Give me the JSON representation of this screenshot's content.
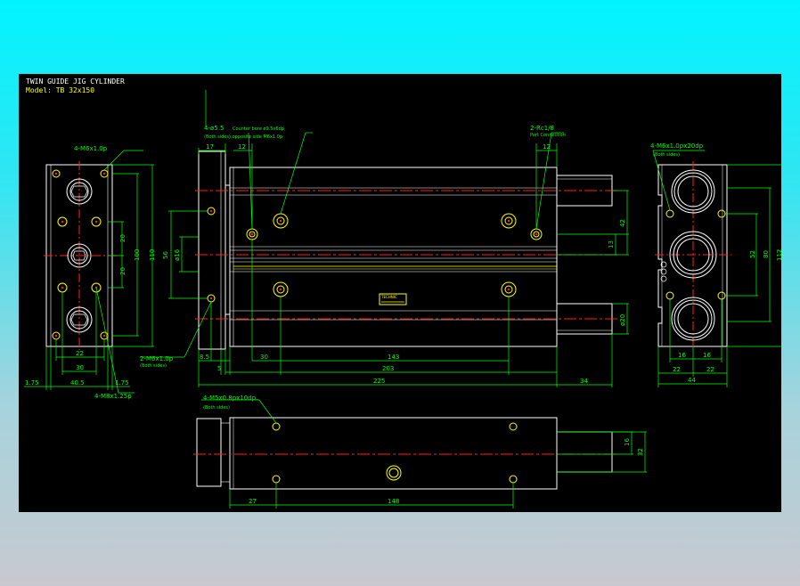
{
  "drawing": {
    "title": "TWIN GUIDE JIG CYLINDER",
    "model": "Model: TB 32x150",
    "colors": {
      "background": "#000000",
      "outline": "#ffffff",
      "dimension": "#00ff00",
      "centerline": "#ff2020",
      "holes": "#ffff00",
      "label": "#ffff00"
    }
  },
  "left_view": {
    "callout_top": "4-M6x1.0p",
    "callout_bottom": "4-M8x1.25p",
    "dims": {
      "d20a": "20",
      "d20b": "20",
      "d100": "100",
      "d110": "110",
      "d22": "22",
      "d30": "30",
      "d405": "40.5",
      "d175l": "1.75",
      "d175r": "1.75"
    }
  },
  "front_view": {
    "callout_cbore": "4-ø5.5",
    "callout_cbore_note": "Counter bore ø9.5x6dp",
    "callout_cbore_note2": "(Both sides),opposite side M6x1.0p",
    "callout_port": "2-Rc1/8",
    "callout_port_note": "Port Connection",
    "callout_side": "2-M6x1.0p",
    "callout_side_note": "(Both sides)",
    "nameplate": "TECHNIC",
    "dims": {
      "d17": "17",
      "d12a": "12",
      "d12b": "12",
      "d56": "56",
      "d16dia": "ø16",
      "d13": "13",
      "d42": "42",
      "d20dia": "ø20",
      "d85": "8.5",
      "d5": "5",
      "d30": "30",
      "d143": "143",
      "d203": "203",
      "d225": "225",
      "d34": "34"
    }
  },
  "right_view": {
    "callout": "4-M6x1.0px20dp",
    "callout_note": "(Both sides)",
    "dims": {
      "d52": "52",
      "d80": "80",
      "d112": "112",
      "d16a": "16",
      "d16b": "16",
      "d22a": "22",
      "d22b": "22",
      "d44": "44"
    }
  },
  "bottom_view": {
    "callout": "4-M5x0.8px10dp.",
    "callout_note": "(Both sides)",
    "dims": {
      "d16": "16",
      "d32": "32",
      "d27": "27",
      "d148": "148"
    }
  }
}
